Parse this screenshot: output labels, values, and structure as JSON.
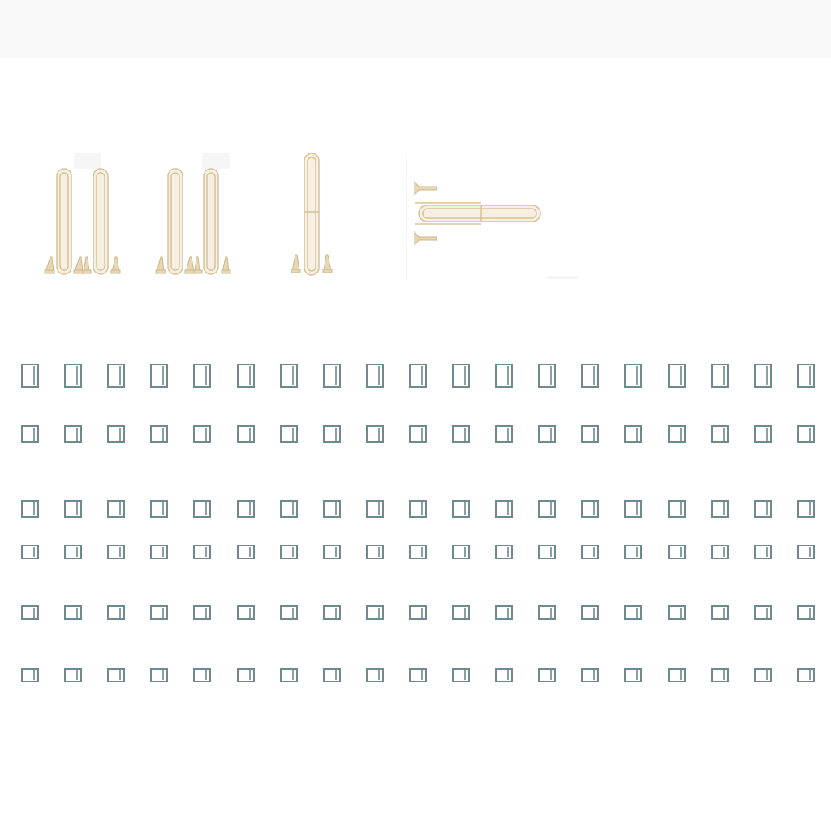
{
  "colors": {
    "background": "#ffffff",
    "top_bar": "#f9f9f9",
    "part_fill": "#efe4cc",
    "part_stroke": "#d7c39a",
    "icon_stroke": "#6f8a8f"
  },
  "toolbar": {},
  "parts": [
    {
      "name": "double-loop-heating-element-with-brackets",
      "icon": "heating-element-icon"
    },
    {
      "name": "double-loop-heating-element-with-brackets-2",
      "icon": "heating-element-icon"
    },
    {
      "name": "single-loop-heating-element",
      "icon": "heating-element-icon"
    },
    {
      "name": "horizontal-heating-element",
      "icon": "heating-element-icon"
    }
  ],
  "icon_grid": {
    "icon": "window-frame-icon",
    "rows": 6,
    "columns": 19
  }
}
